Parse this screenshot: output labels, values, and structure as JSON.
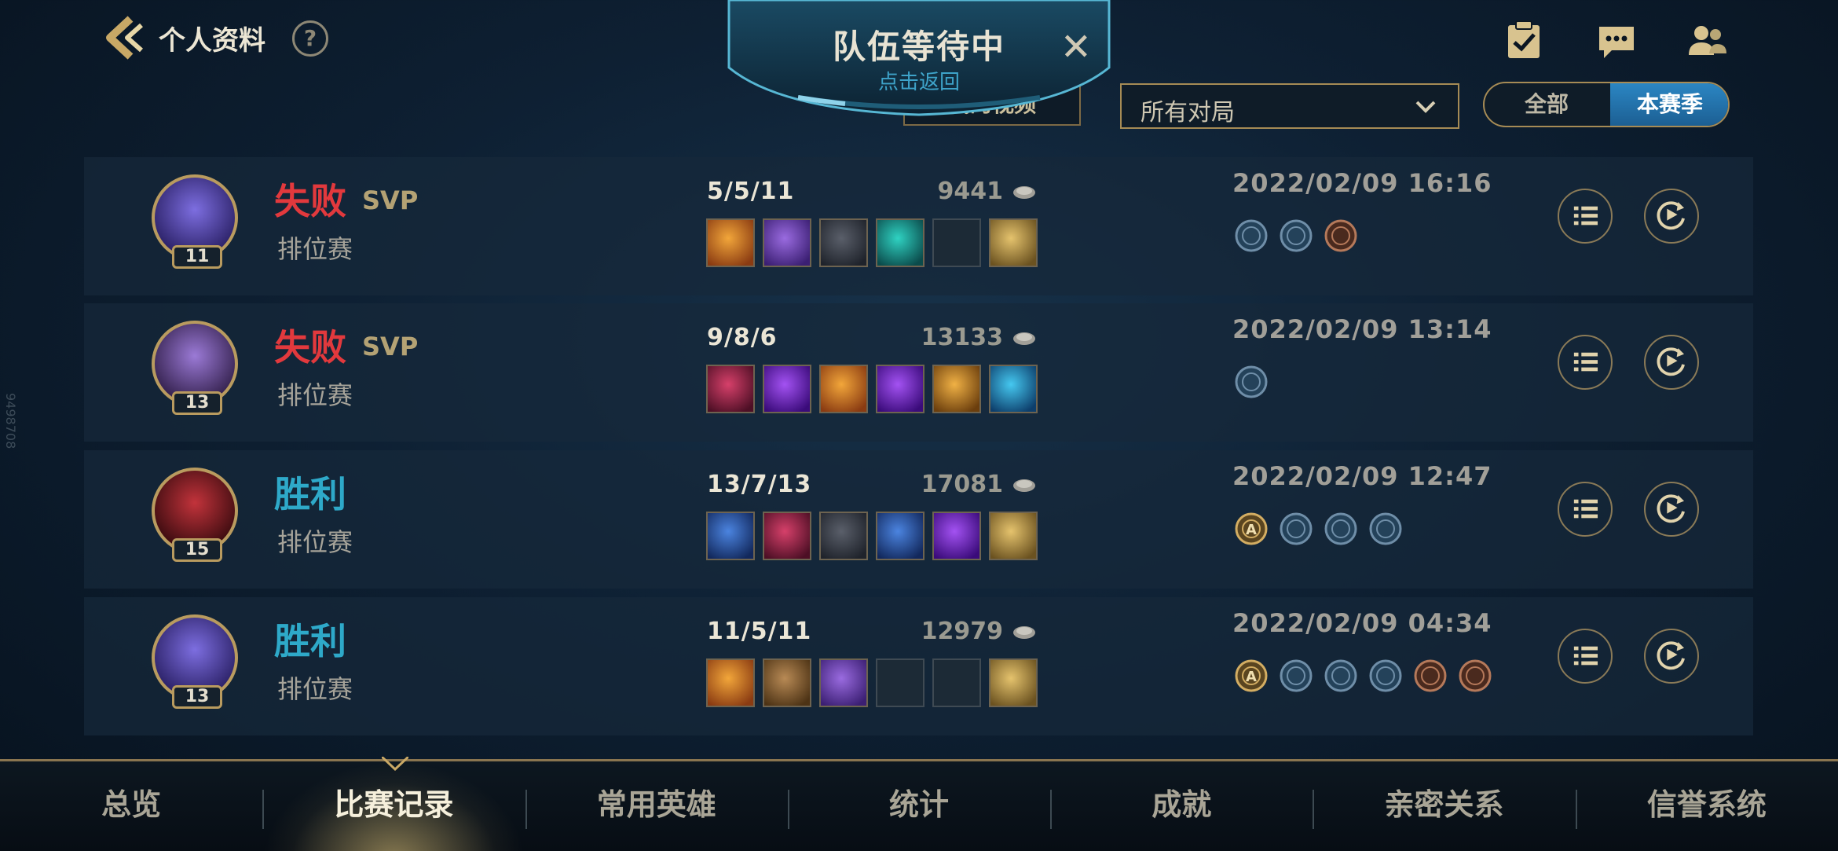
{
  "header": {
    "title": "个人资料",
    "help_label": "?",
    "queue": {
      "title": "队伍等待中",
      "subtitle": "点击返回",
      "close": "✕"
    },
    "video_button": "我的视频",
    "filter": {
      "selected": "所有对局"
    },
    "season_toggle": {
      "all": "全部",
      "season": "本赛季",
      "active": "本赛季"
    },
    "icons": [
      "task-clipboard-icon",
      "chat-bubble-icon",
      "friends-icon"
    ]
  },
  "side_text": "9498708",
  "matches": [
    {
      "result": "失败",
      "outcome": "lose",
      "svp": "SVP",
      "mode": "排位赛",
      "level": "11",
      "kda": "5/5/11",
      "gold": "9441",
      "items": [
        "orange",
        "violet",
        "dark",
        "teal",
        "empty",
        "gold"
      ],
      "date": "2022/02/09 16:16",
      "badges": [
        "blue",
        "blue",
        "bronze"
      ]
    },
    {
      "result": "失败",
      "outcome": "lose",
      "svp": "SVP",
      "mode": "排位赛",
      "level": "13",
      "kda": "9/8/6",
      "gold": "13133",
      "items": [
        "red",
        "purple",
        "orange",
        "purple",
        "amber",
        "cyan"
      ],
      "date": "2022/02/09 13:14",
      "badges": [
        "blue"
      ]
    },
    {
      "result": "胜利",
      "outcome": "win",
      "svp": "",
      "mode": "排位赛",
      "level": "15",
      "kda": "13/7/13",
      "gold": "17081",
      "items": [
        "blue",
        "red",
        "dark",
        "blue",
        "purple",
        "gold"
      ],
      "date": "2022/02/09 12:47",
      "badges": [
        "gold-a",
        "blue",
        "blue",
        "blue"
      ]
    },
    {
      "result": "胜利",
      "outcome": "win",
      "svp": "",
      "mode": "排位赛",
      "level": "13",
      "kda": "11/5/11",
      "gold": "12979",
      "items": [
        "orange",
        "bronze",
        "violet",
        "empty",
        "empty",
        "gold"
      ],
      "date": "2022/02/09 04:34",
      "badges": [
        "gold-a",
        "blue",
        "blue",
        "blue",
        "bronze",
        "bronze"
      ]
    }
  ],
  "nav": {
    "tabs": [
      "总览",
      "比赛记录",
      "常用英雄",
      "统计",
      "成就",
      "亲密关系",
      "信誉系统"
    ],
    "active": "比赛记录"
  },
  "colors": {
    "lose": "#e2393d",
    "win": "#2ea9c9",
    "accent_gold": "#b99b5f",
    "toggle_active": "#2b86c3"
  }
}
